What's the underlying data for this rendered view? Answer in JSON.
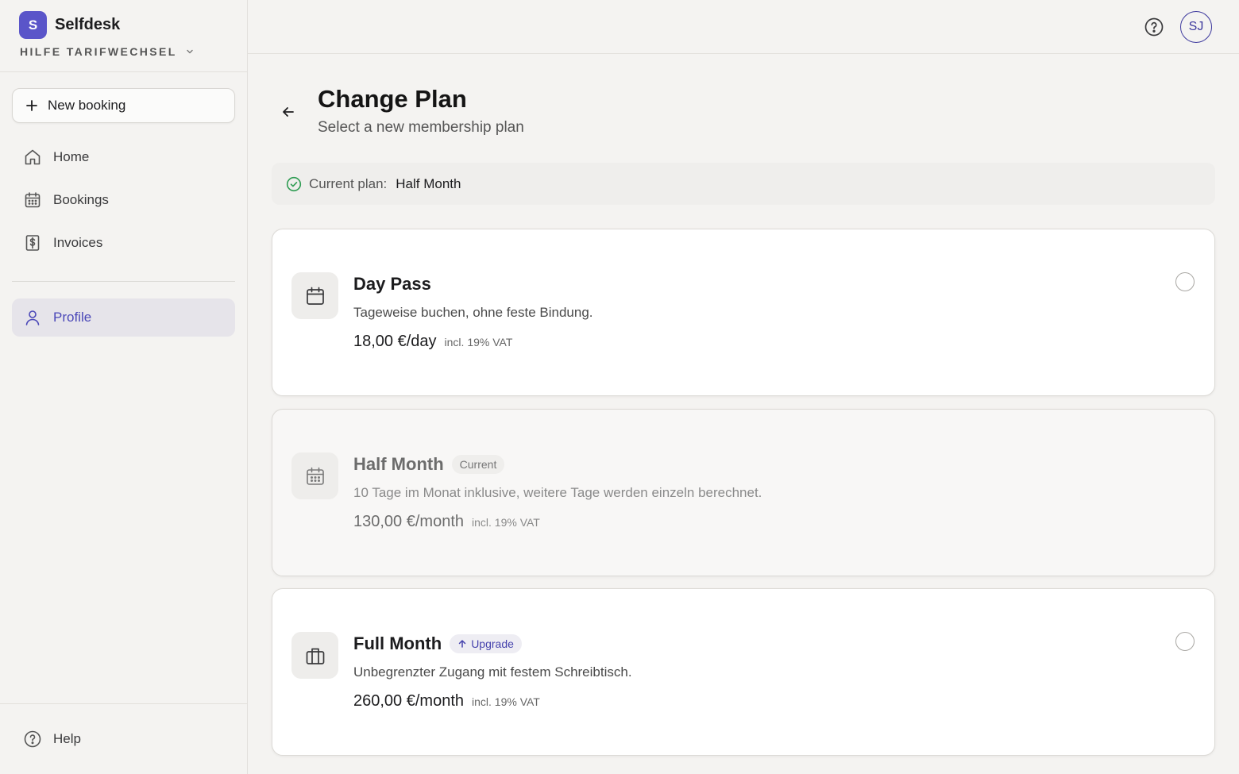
{
  "brand": {
    "logo_letter": "S",
    "name": "Selfdesk",
    "workspace": "HILFE TARIFWECHSEL"
  },
  "sidebar": {
    "new_booking": "New booking",
    "items": [
      {
        "label": "Home",
        "icon": "home-icon"
      },
      {
        "label": "Bookings",
        "icon": "calendar-icon"
      },
      {
        "label": "Invoices",
        "icon": "invoice-icon"
      },
      {
        "label": "Profile",
        "icon": "user-icon",
        "active": true
      }
    ],
    "help": "Help"
  },
  "topbar": {
    "avatar_initials": "SJ"
  },
  "page": {
    "title": "Change Plan",
    "subtitle": "Select a new membership plan",
    "current_plan_label": "Current plan:",
    "current_plan_value": "Half Month"
  },
  "plans": [
    {
      "name": "Day Pass",
      "badge": "",
      "description": "Tageweise buchen, ohne feste Bindung.",
      "price": "18,00 €/day",
      "vat": "incl. 19% VAT",
      "icon": "calendar-icon"
    },
    {
      "name": "Half Month",
      "badge": "Current",
      "description": "10 Tage im Monat inklusive, weitere Tage werden einzeln berechnet.",
      "price": "130,00 €/month",
      "vat": "incl. 19% VAT",
      "icon": "calendar-grid-icon"
    },
    {
      "name": "Full Month",
      "badge": "Upgrade",
      "description": "Unbegrenzter Zugang mit festem Schreibtisch.",
      "price": "260,00 €/month",
      "vat": "incl. 19% VAT",
      "icon": "briefcase-icon"
    }
  ],
  "colors": {
    "accent": "#5a55c9",
    "active_text": "#4b48b8",
    "success": "#2e9c52"
  }
}
